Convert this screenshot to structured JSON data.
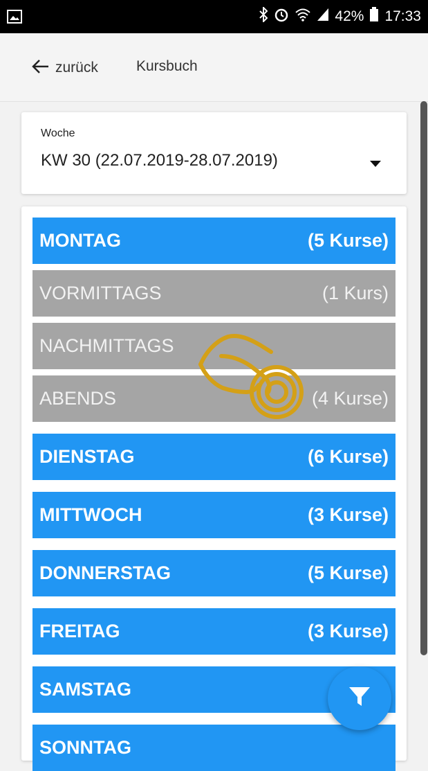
{
  "statusbar": {
    "battery": "42%",
    "time": "17:33"
  },
  "topbar": {
    "back_label": "zurück",
    "title": "Kursbuch"
  },
  "week": {
    "label": "Woche",
    "value": "KW 30 (22.07.2019-28.07.2019)"
  },
  "days": [
    {
      "name": "MONTAG",
      "count": "(5 Kurse)",
      "kind": "day"
    },
    {
      "name": "VORMITTAGS",
      "count": "(1 Kurs)",
      "kind": "sub"
    },
    {
      "name": "NACHMITTAGS",
      "count": "",
      "kind": "sub"
    },
    {
      "name": "ABENDS",
      "count": "(4 Kurse)",
      "kind": "sub"
    },
    {
      "name": "DIENSTAG",
      "count": "(6 Kurse)",
      "kind": "day"
    },
    {
      "name": "MITTWOCH",
      "count": "(3 Kurse)",
      "kind": "day"
    },
    {
      "name": "DONNERSTAG",
      "count": "(5 Kurse)",
      "kind": "day"
    },
    {
      "name": "FREITAG",
      "count": "(3 Kurse)",
      "kind": "day"
    },
    {
      "name": "SAMSTAG",
      "count": "",
      "kind": "day"
    },
    {
      "name": "SONNTAG",
      "count": "",
      "kind": "day"
    }
  ],
  "colors": {
    "day": "#2196f3",
    "sub": "#a5a5a5",
    "hand": "#d4a017"
  },
  "icons": {
    "status": [
      "image-icon",
      "bluetooth-icon",
      "alarm-icon",
      "wifi-icon",
      "signal-icon",
      "battery-icon"
    ],
    "back": "arrow-left-icon",
    "dropdown": "caret-down-icon",
    "fab": "filter-icon",
    "hand": "tap-gesture-icon"
  }
}
